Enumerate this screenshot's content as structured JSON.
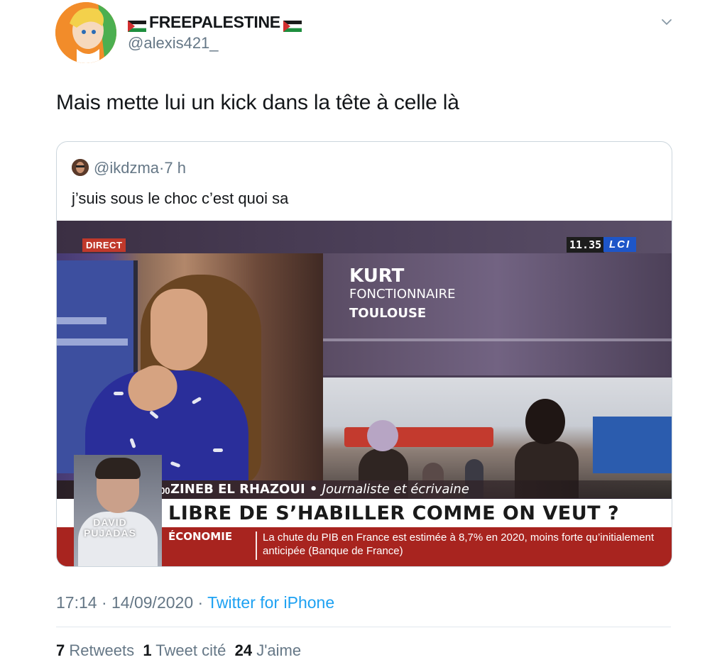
{
  "tweet": {
    "display_name": "FREEPALESTINE",
    "handle": "@alexis421_",
    "text": "Mais mette lui un kick dans la tête à celle là",
    "timestamp": "17:14 · 14/09/2020 · ",
    "source": "Twitter for iPhone",
    "retweets_count": "7",
    "retweets_label": "Retweets",
    "quotes_count": "1",
    "quotes_label": "Tweet cité",
    "likes_count": "24",
    "likes_label": "J'aime",
    "icons": [
      "palestine-flag-icon",
      "chevron-down-icon"
    ]
  },
  "quoted": {
    "handle": "@ikdzma",
    "age": "·7 h",
    "text": "j’suis sous le choc c’est quoi sa",
    "video": {
      "live_badge": "DIRECT",
      "clock": "11.35",
      "channel": "LCI",
      "guest_name": "KURT",
      "guest_role": "FONCTIONNAIRE",
      "guest_city": "TOULOUSE",
      "show_time": "18.00",
      "speaker_name": "ZINEB EL RHAZOUI",
      "speaker_sep": " • ",
      "speaker_role": "Journaliste et écrivaine",
      "headline": "LIBRE DE S’HABILLER COMME ON VEUT ?",
      "ticker_label": "ÉCONOMIE",
      "ticker_text": "La chute du PIB en France est estimée à 8,7% en 2020, moins forte qu’initialement anticipée (Banque de France)",
      "inset_label": "DAVID PUJADAS"
    }
  },
  "colors": {
    "link": "#1da1f2",
    "secondary_text": "#657786",
    "ticker_red": "#a8241f",
    "lci_blue": "#1e56c8"
  }
}
